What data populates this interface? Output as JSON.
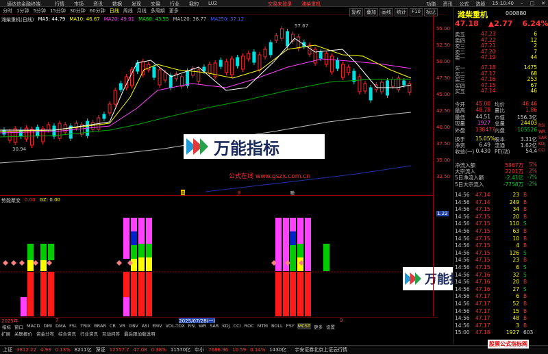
{
  "app": {
    "brand": "通达信金融终端",
    "menu": [
      "行情",
      "市场",
      "资讯",
      "数据",
      "发现",
      "交易",
      "行业",
      "我的",
      "LU2"
    ],
    "login_alert": "交易未登录",
    "stock_tab": "潍柴重机",
    "right_menu": [
      "功能",
      "资讯",
      "公式",
      "选股"
    ],
    "clock": "15:10:40"
  },
  "periods": [
    "分时",
    "1分钟",
    "5分钟",
    "15分钟",
    "30分钟",
    "60分钟",
    "日线",
    "周线",
    "月线",
    "多周期",
    "更多"
  ],
  "active_period": "日线",
  "right_tabs": [
    "复权",
    "叠加",
    "画线",
    "统计",
    "F10",
    "标记"
  ],
  "ma_line": {
    "name": "潍柴重机(日线)",
    "items": [
      {
        "label": "MA5: 44.79",
        "color": "#ffffff"
      },
      {
        "label": "MA10: 46.67",
        "color": "#ffff00"
      },
      {
        "label": "MA20: 49.01",
        "color": "#ff40ff"
      },
      {
        "label": "MA60: 43.55",
        "color": "#00ff00"
      },
      {
        "label": "MA120: 38.77",
        "color": "#c0c0c0"
      },
      {
        "label": "MA250: 37.12",
        "color": "#4060ff"
      }
    ]
  },
  "chart_annotations": {
    "high": "57.67",
    "low": "30.94",
    "gs_text": "公式在线  www.gszx.com.cn",
    "markers": [
      "卖",
      "多",
      "聪"
    ]
  },
  "price_axis": [
    "55.00",
    "52.50",
    "50.00",
    "47.50",
    "45.00",
    "42.50",
    "40.00",
    "37.50",
    "35.00",
    "32.50"
  ],
  "indicator": {
    "name": "势能聚变",
    "v1": "0.00",
    "v2": "GZ: 0.00",
    "axis_top": "1.22"
  },
  "bottom_dates": [
    "2025年",
    "7",
    "2025/07/28(一)",
    "9"
  ],
  "indicator_tabs": [
    "指标",
    "窗口",
    "MACD",
    "DMI",
    "DMA",
    "FSL",
    "TRIX",
    "BRAR",
    "CR",
    "VR",
    "OBV",
    "ASI",
    "EMV",
    "VOL-TDX",
    "RSI",
    "WR",
    "SAR",
    "KDJ",
    "CCI",
    "ROC",
    "MTM",
    "BOLL",
    "PSY",
    "MCST",
    "更多",
    "设置"
  ],
  "selected_indicator_tab": "MCST",
  "bottom_tabs": [
    "扩展",
    "关联报价",
    "资金分布",
    "综合资讯",
    "行业资讯",
    "互动问答",
    "最后跟加载说明"
  ],
  "status": {
    "sh_label": "上证",
    "sh_val": "3812.22",
    "sh_chg": "4.93",
    "sh_pct": "0.13%",
    "sh_amt": "8211亿",
    "sz_label": "深证",
    "sz_val": "12557.7",
    "sz_chg": "47.08",
    "sz_pct": "0.38%",
    "sz_amt": "11570亿",
    "zx_label": "中小",
    "zx_val": "7686.96",
    "zx_chg": "10.59",
    "zx_pct": "0.14%",
    "zx_amt": "1430亿",
    "notice": "宇安证券北京上证云行情"
  },
  "quote": {
    "name": "潍柴重机",
    "code": "000880",
    "price": "47.18",
    "change": "▲2.77",
    "pct": "6.24%",
    "asks": [
      {
        "label": "卖五",
        "price": "47.23",
        "vol": "6"
      },
      {
        "label": "卖四",
        "price": "47.22",
        "vol": "12"
      },
      {
        "label": "卖三",
        "price": "47.21",
        "vol": "2"
      },
      {
        "label": "卖二",
        "price": "47.20",
        "vol": "7"
      },
      {
        "label": "卖一",
        "price": "47.19",
        "vol": "44"
      }
    ],
    "bids": [
      {
        "label": "买一",
        "price": "47.18",
        "vol": "1475"
      },
      {
        "label": "买二",
        "price": "47.17",
        "vol": "68"
      },
      {
        "label": "买三",
        "price": "47.16",
        "vol": "253"
      },
      {
        "label": "买四",
        "price": "47.15",
        "vol": "67"
      },
      {
        "label": "买五",
        "price": "47.14",
        "vol": "46"
      }
    ],
    "stats": [
      {
        "a": "今开",
        "b": "45.00",
        "c": "均价",
        "d": "46.46",
        "bc": "up",
        "dc": "up"
      },
      {
        "a": "最高",
        "b": "48.78",
        "c": "量比",
        "d": "1.86",
        "bc": "up",
        "dc": "up"
      },
      {
        "a": "最低",
        "b": "44.51",
        "c": "市值",
        "d": "156.3亿",
        "bc": "wt",
        "dc": "wt"
      },
      {
        "a": "现量",
        "b": "1927",
        "c": "总量",
        "d": "24403",
        "bc": "mg",
        "dc": "yl"
      },
      {
        "a": "外盘",
        "b": "138477",
        "c": "内盘",
        "d": "105526",
        "bc": "up",
        "dc": "dn"
      },
      {
        "a": "换手",
        "b": "15.05%",
        "c": "股本",
        "d": "3.31亿",
        "bc": "yl",
        "dc": "wt"
      },
      {
        "a": "净资",
        "b": "6.49",
        "c": "流通",
        "d": "1.62亿",
        "bc": "wt",
        "dc": "wt"
      },
      {
        "a": "收益(一)",
        "b": "0.430",
        "c": "PE(动)",
        "d": "54.4",
        "bc": "wt",
        "dc": "wt"
      }
    ],
    "flows": [
      {
        "label": "净流入额",
        "val": "5967万",
        "pct": "5%",
        "c": "up"
      },
      {
        "label": "大宗流入",
        "val": "2201万",
        "pct": "2%",
        "c": "up"
      },
      {
        "label": "5日净流入额",
        "val": "-2.41亿",
        "pct": "-7%",
        "c": "dn"
      },
      {
        "label": "5日大宗流入",
        "val": "-7758万",
        "pct": "-2%",
        "c": "dn"
      }
    ],
    "ticks": [
      {
        "t": "14:56",
        "p": "47.14",
        "v": "23",
        "s": "B"
      },
      {
        "t": "14:56",
        "p": "47.14",
        "v": "249",
        "s": "B"
      },
      {
        "t": "14:56",
        "p": "47.15",
        "v": "34",
        "s": "B"
      },
      {
        "t": "14:56",
        "p": "47.15",
        "v": "20",
        "s": "B"
      },
      {
        "t": "14:56",
        "p": "47.15",
        "v": "110",
        "s": "S"
      },
      {
        "t": "14:56",
        "p": "47.15",
        "v": "63",
        "s": "B"
      },
      {
        "t": "14:56",
        "p": "47.15",
        "v": "10",
        "s": "B"
      },
      {
        "t": "14:56",
        "p": "47.15",
        "v": "4",
        "s": "B"
      },
      {
        "t": "14:56",
        "p": "47.15",
        "v": "126",
        "s": "S"
      },
      {
        "t": "14:56",
        "p": "47.15",
        "v": "23",
        "s": "B"
      },
      {
        "t": "14:56",
        "p": "47.15",
        "v": "6",
        "s": "S"
      },
      {
        "t": "14:56",
        "p": "47.16",
        "v": "32",
        "s": "S"
      },
      {
        "t": "14:56",
        "p": "47.16",
        "v": "20",
        "s": "B"
      },
      {
        "t": "14:56",
        "p": "47.16",
        "v": "27",
        "s": "S"
      },
      {
        "t": "14:56",
        "p": "47.17",
        "v": "6",
        "s": "B"
      },
      {
        "t": "14:56",
        "p": "47.17",
        "v": "52",
        "s": "B"
      },
      {
        "t": "14:56",
        "p": "47.17",
        "v": "15",
        "s": "B"
      },
      {
        "t": "14:56",
        "p": "47.17",
        "v": "48",
        "s": "B"
      },
      {
        "t": "14:56",
        "p": "47.17",
        "v": "3",
        "s": "B"
      },
      {
        "t": "15:00",
        "p": "47.18",
        "v": "1927",
        "s": "603"
      }
    ],
    "right_side_tabs": [
      "RSI",
      "WR",
      "SAR",
      "KDJ",
      "CCI"
    ]
  },
  "watermark": {
    "text": "万能指标"
  },
  "footer_brand": "股票公式指标网"
}
